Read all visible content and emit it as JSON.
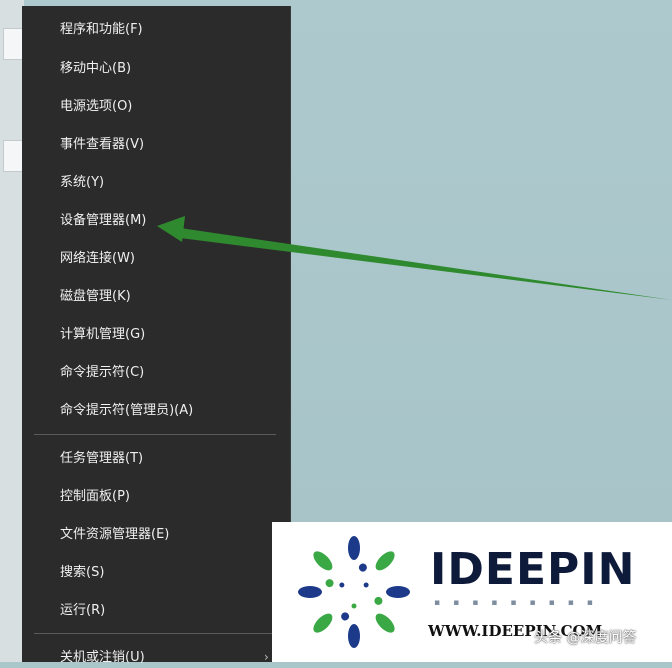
{
  "menu": {
    "items": [
      {
        "label": "程序和功能(F)"
      },
      {
        "label": "移动中心(B)"
      },
      {
        "label": "电源选项(O)"
      },
      {
        "label": "事件查看器(V)"
      },
      {
        "label": "系统(Y)"
      },
      {
        "label": "设备管理器(M)"
      },
      {
        "label": "网络连接(W)"
      },
      {
        "label": "磁盘管理(K)"
      },
      {
        "label": "计算机管理(G)"
      },
      {
        "label": "命令提示符(C)"
      },
      {
        "label": "命令提示符(管理员)(A)"
      },
      {
        "label": "任务管理器(T)"
      },
      {
        "label": "控制面板(P)"
      },
      {
        "label": "文件资源管理器(E)"
      },
      {
        "label": "搜索(S)"
      },
      {
        "label": "运行(R)"
      },
      {
        "label": "关机或注销(U)"
      }
    ]
  },
  "logo": {
    "brand": "IDEEPIN",
    "site": "WWW.IDEEPIN.COM"
  },
  "watermark": "头条 @深度问答",
  "colors": {
    "menu_bg": "#2b2b2b",
    "menu_text": "#f0f0f0",
    "arrow": "#2f8a2f",
    "desktop": "#a9c7cb",
    "brand": "#0e1a3a"
  }
}
